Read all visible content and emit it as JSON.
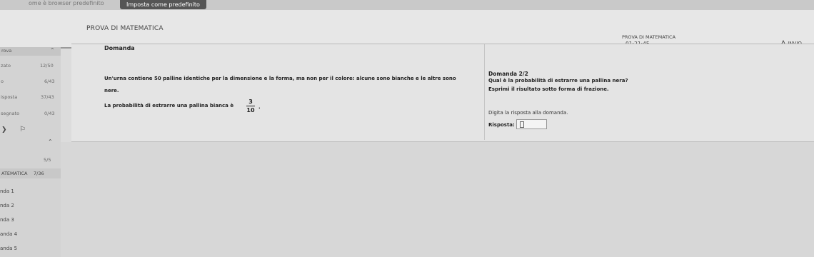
{
  "browser_bar": {
    "note": "ome è browser predefinito",
    "default_button": "Imposta come predefinito"
  },
  "header": {
    "title": "PROVA DI MATEMATICA",
    "right_title": "PROVA DI MATEMATICA",
    "timer": "01:21:45",
    "send_label": "INVIO"
  },
  "sidebar": {
    "top_label": "rova",
    "stats": [
      {
        "label": "zato",
        "value": "12/50"
      },
      {
        "label": "o",
        "value": "6/43"
      },
      {
        "label": "isposta",
        "value": "37/43"
      },
      {
        "label": "segnato",
        "value": "0/43"
      }
    ],
    "section_count": "5/5",
    "section_title": "ATEMATICA",
    "section_value": "7/36",
    "items": [
      "nda 1",
      "nda 2",
      "nda 3",
      "anda 4",
      "anda 5"
    ]
  },
  "question": {
    "label": "Domanda",
    "text_line1": "Un'urna contiene 50 palline identiche per la dimensione e la forma, ma non per il colore: alcune sono bianche e le altre sono",
    "text_line2": "nere.",
    "probability_text": "La probabilità di estrarre una pallina bianca è",
    "fraction_num": "3",
    "fraction_den": "10",
    "fraction_end": "."
  },
  "answer_panel": {
    "counter": "Domanda 2/2",
    "prompt": "Qual è la probabilità di estrarre una pallina nera?",
    "instruction": "Esprimi il risultato sotto forma di frazione.",
    "hint": "Digita la risposta alla domanda.",
    "answer_label": "Risposta:",
    "answer_value": ""
  }
}
